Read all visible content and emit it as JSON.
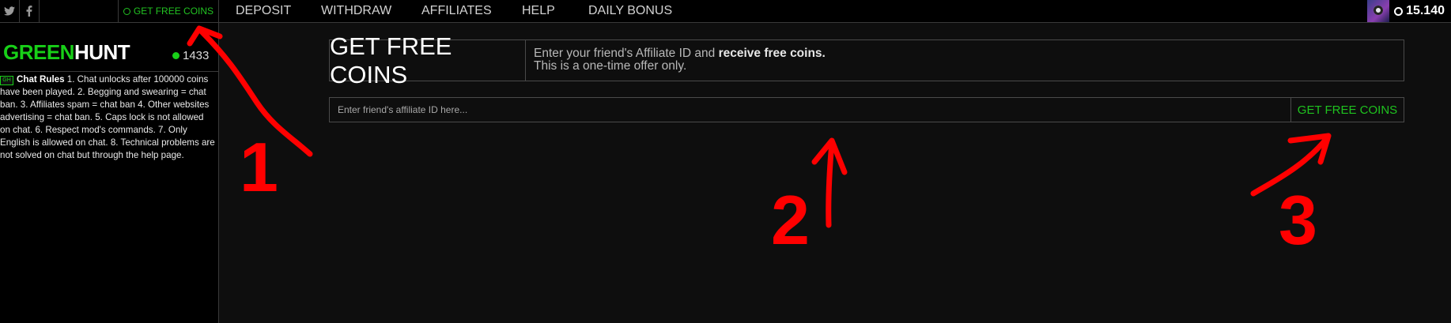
{
  "topbar": {
    "social": [
      {
        "icon": "twitter-icon"
      },
      {
        "icon": "facebook-icon"
      }
    ],
    "nav_active": {
      "label": "GET FREE COINS",
      "icon": "coin-icon"
    },
    "nav": [
      {
        "label": "DEPOSIT"
      },
      {
        "label": "WITHDRAW"
      },
      {
        "label": "AFFILIATES"
      },
      {
        "label": "HELP"
      },
      {
        "label": "DAILY BONUS"
      }
    ],
    "balance": "15.140"
  },
  "sidebar": {
    "logo_part1": "GREEN",
    "logo_part2": "HUNT",
    "online_count": "1433",
    "rules_badge": "GH",
    "rules_title": "Chat Rules",
    "rules_text": " 1. Chat unlocks after 100000 coins have been played. 2. Begging and swearing = chat ban. 3. Affiliates spam = chat ban 4. Other websites advertising = chat ban. 5. Caps lock is not allowed on chat. 6. Respect mod's commands. 7. Only English is allowed on chat. 8. Technical problems are not solved on chat but through the help page."
  },
  "main": {
    "title": "GET FREE COINS",
    "desc_prefix": "Enter your friend's Affiliate ID and ",
    "desc_bold": "receive free coins.",
    "desc_line2": "This is a one-time offer only.",
    "input_placeholder": "Enter friend's affiliate ID here...",
    "button_label": "GET FREE COINS"
  },
  "annotations": {
    "color": "#ff0000",
    "numbers": [
      "1",
      "2",
      "3"
    ]
  },
  "colors": {
    "accent_green": "#1fc21f",
    "background": "#0e0e0e",
    "bar": "#000000"
  }
}
